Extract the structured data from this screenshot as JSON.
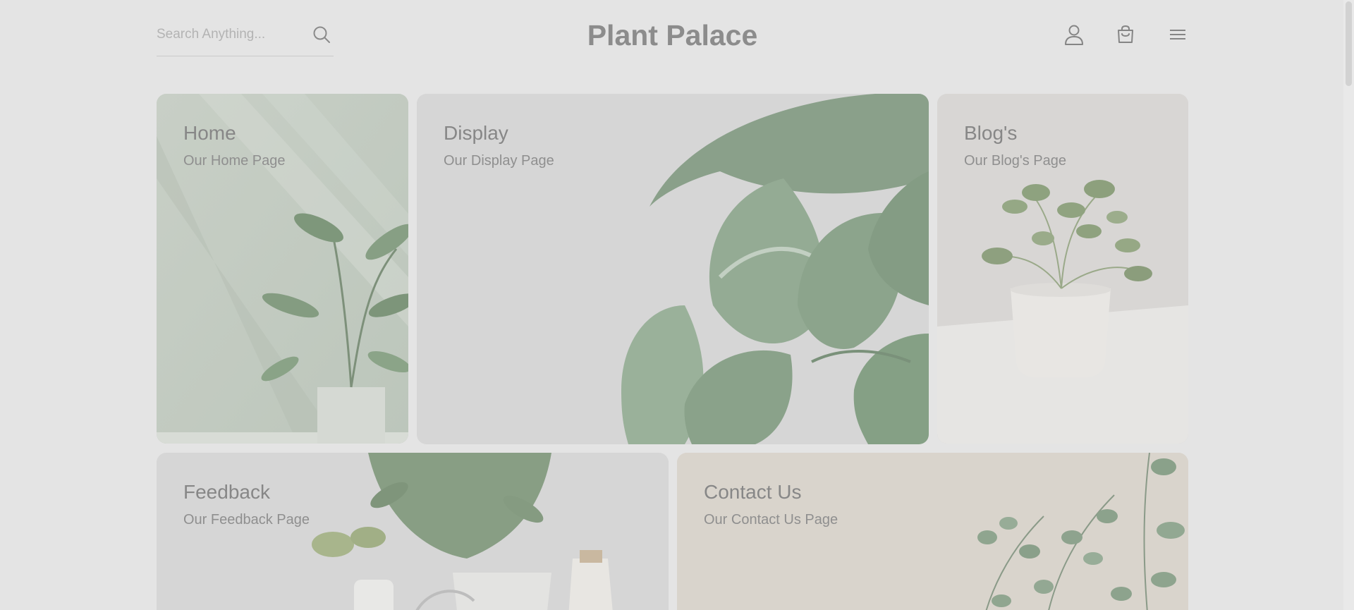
{
  "header": {
    "brand": "Plant Palace",
    "search": {
      "placeholder": "Search Anything...",
      "value": "",
      "icon": "search-icon"
    },
    "icons": [
      "user-icon",
      "shopping-bag-icon",
      "menu-icon"
    ]
  },
  "cards": [
    {
      "title": "Home",
      "subtitle": "Our Home Page",
      "image": "plant-image"
    },
    {
      "title": "Display",
      "subtitle": "Our Display Page",
      "image": "pothos-leaves-image"
    },
    {
      "title": "Blog's",
      "subtitle": "Our Blog's Page",
      "image": "potted-pilea-image"
    },
    {
      "title": "Feedback",
      "subtitle": "Our Feedback Page",
      "image": "houseplants-image"
    },
    {
      "title": "Contact Us",
      "subtitle": "Our Contact Us Page",
      "image": "eucalyptus-image"
    }
  ],
  "colors": {
    "page_background": "#e4e4e4",
    "brand_text": "#8c8c8c",
    "card_text": "#878787",
    "leaf_green": "#8aa389"
  }
}
